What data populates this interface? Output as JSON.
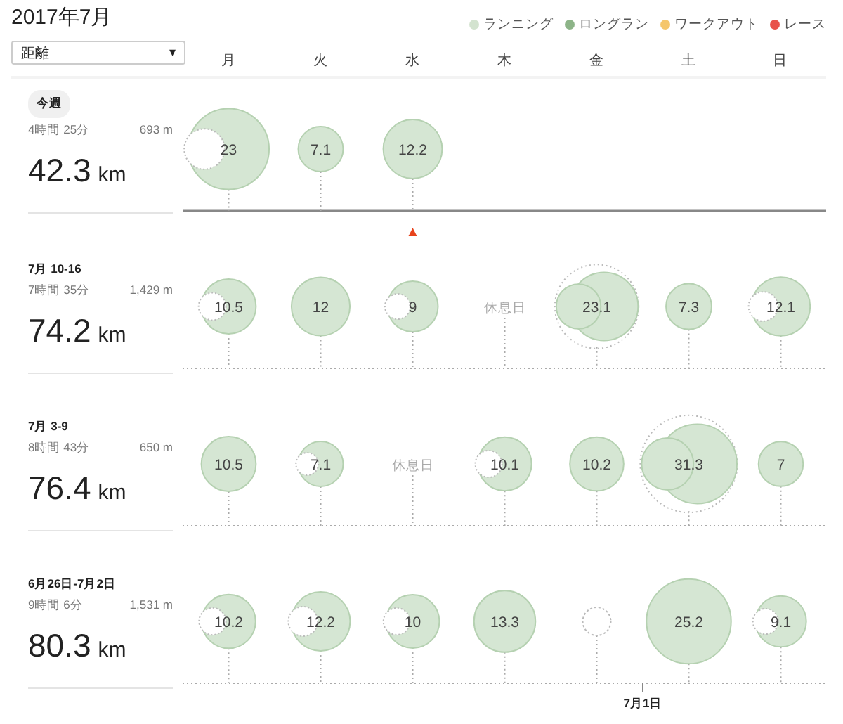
{
  "title": "2017年7月",
  "metric_dropdown": {
    "value": "距離",
    "caret": "▾"
  },
  "legend": [
    {
      "label": "ランニング",
      "color": "#d3e3cf"
    },
    {
      "label": "ロングラン",
      "color": "#8db488"
    },
    {
      "label": "ワークアウト",
      "color": "#f5c66c"
    },
    {
      "label": "レース",
      "color": "#e8534b"
    }
  ],
  "weekdays": [
    "月",
    "火",
    "水",
    "木",
    "金",
    "土",
    "日"
  ],
  "weeks": [
    {
      "label": "今週",
      "current": true,
      "time": "4時間 25分",
      "elevation": "693 m",
      "distance": "42.3",
      "unit": "km",
      "days": [
        {
          "kind": "run",
          "value": "23",
          "notch": true,
          "double": false,
          "today": false
        },
        {
          "kind": "run",
          "value": "7.1",
          "notch": false,
          "double": false,
          "today": false
        },
        {
          "kind": "run",
          "value": "12.2",
          "notch": false,
          "double": false,
          "today": true
        }
      ]
    },
    {
      "label": "7月 10-16",
      "current": false,
      "time": "7時間 35分",
      "elevation": "1,429 m",
      "distance": "74.2",
      "unit": "km",
      "days": [
        {
          "kind": "run",
          "value": "10.5",
          "notch": true,
          "double": false,
          "today": false
        },
        {
          "kind": "run",
          "value": "12",
          "notch": false,
          "double": false,
          "today": false
        },
        {
          "kind": "run",
          "value": "9",
          "notch": true,
          "double": false,
          "today": false
        },
        {
          "kind": "rest",
          "value": "休息日",
          "today": false
        },
        {
          "kind": "run",
          "value": "23.1",
          "notch": false,
          "double": true,
          "today": false
        },
        {
          "kind": "run",
          "value": "7.3",
          "notch": false,
          "double": false,
          "today": false
        },
        {
          "kind": "run",
          "value": "12.1",
          "notch": true,
          "double": false,
          "today": false
        }
      ]
    },
    {
      "label": "7月 3-9",
      "current": false,
      "time": "8時間 43分",
      "elevation": "650 m",
      "distance": "76.4",
      "unit": "km",
      "days": [
        {
          "kind": "run",
          "value": "10.5",
          "notch": false,
          "double": false,
          "today": false
        },
        {
          "kind": "run",
          "value": "7.1",
          "notch": true,
          "double": false,
          "today": false
        },
        {
          "kind": "rest",
          "value": "休息日",
          "today": false
        },
        {
          "kind": "run",
          "value": "10.1",
          "notch": true,
          "double": false,
          "today": false
        },
        {
          "kind": "run",
          "value": "10.2",
          "notch": false,
          "double": false,
          "today": false
        },
        {
          "kind": "run",
          "value": "31.3",
          "notch": false,
          "double": true,
          "today": false
        },
        {
          "kind": "run",
          "value": "7",
          "notch": false,
          "double": false,
          "today": false
        }
      ]
    },
    {
      "label": "6月26日-7月2日",
      "current": false,
      "time": "9時間 6分",
      "elevation": "1,531 m",
      "distance": "80.3",
      "unit": "km",
      "days": [
        {
          "kind": "run",
          "value": "10.2",
          "notch": true,
          "double": false,
          "today": false
        },
        {
          "kind": "run",
          "value": "12.2",
          "notch": true,
          "double": false,
          "today": false
        },
        {
          "kind": "run",
          "value": "10",
          "notch": true,
          "double": false,
          "today": false
        },
        {
          "kind": "run",
          "value": "13.3",
          "notch": false,
          "double": false,
          "today": false
        },
        {
          "kind": "empty",
          "today": false
        },
        {
          "kind": "run",
          "value": "25.2",
          "notch": false,
          "double": false,
          "today": false,
          "month_start_label": "7月1日"
        },
        {
          "kind": "run",
          "value": "9.1",
          "notch": true,
          "double": false,
          "today": false
        }
      ]
    }
  ]
}
